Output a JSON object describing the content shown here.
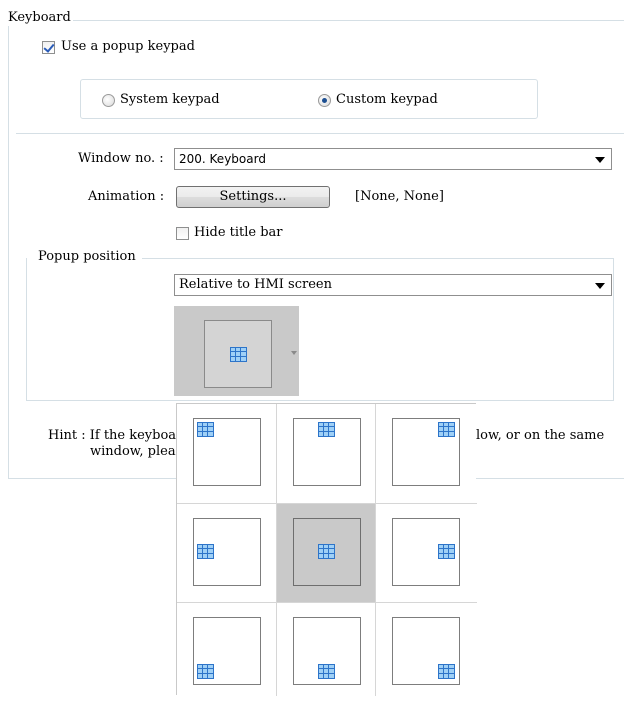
{
  "keyboard_group": {
    "title": "Keyboard",
    "use_popup": {
      "label": "Use a popup keypad",
      "checked": true
    },
    "keypad_type": {
      "options": [
        {
          "label": "System keypad",
          "selected": false
        },
        {
          "label": "Custom keypad",
          "selected": true
        }
      ]
    }
  },
  "window_no": {
    "label": "Window no. :",
    "value": "200. Keyboard"
  },
  "animation": {
    "label": "Animation :",
    "button": "Settings...",
    "value": "[None, None]"
  },
  "hide_title_bar": {
    "label": "Hide title bar",
    "checked": false
  },
  "popup_position": {
    "title": "Popup position",
    "reference": "Relative to HMI screen",
    "selected_anchor": "center",
    "anchors": [
      "top-left",
      "top-center",
      "top-right",
      "middle-left",
      "center",
      "middle-right",
      "bottom-left",
      "bottom-center",
      "bottom-right"
    ]
  },
  "hint": {
    "line1": "Hint : If the keyboa",
    "line1_end": "low, or on the same",
    "line2": "window, plea"
  },
  "colors": {
    "accent": "#2d74c9",
    "icon_fill": "#9fd0f6",
    "selected_bg": "#c9c9c9"
  },
  "icons": [
    "checkbox-checked",
    "radio-button",
    "dropdown-arrow",
    "position-grid-icon"
  ]
}
